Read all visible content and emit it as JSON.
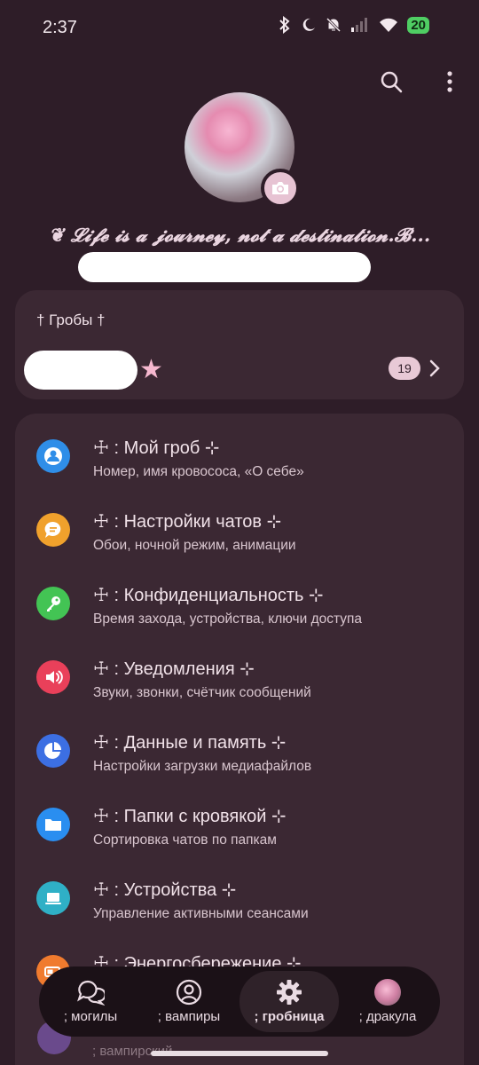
{
  "status_bar": {
    "time": "2:37",
    "battery": "20"
  },
  "profile": {
    "bio": "❦ 𝓛𝓲𝓯𝓮 𝓲𝓼 𝓪 𝓳𝓸𝓾𝓻𝓷𝓮𝔂, 𝓷𝓸𝓽 𝓪 𝓭𝓮𝓼𝓽𝓲𝓷𝓪𝓽𝓲𝓸𝓷.𝓑..."
  },
  "section": {
    "title": "† Гробы †",
    "star": "★",
    "count": "19"
  },
  "menu": [
    {
      "title": "☩ : Мой гроб ⊹",
      "subtitle": "Номер, имя кровососа, «О себе»",
      "icon": "person-icon",
      "color": "#2f8ee8"
    },
    {
      "title": "☩ : Настройки чатов ⊹",
      "subtitle": "Обои, ночной режим, анимации",
      "icon": "chat-bubble-icon",
      "color": "#f0a12c"
    },
    {
      "title": "☩ : Конфиденциальность ⊹",
      "subtitle": "Время захода, устройства, ключи доступа",
      "icon": "key-icon",
      "color": "#43c454"
    },
    {
      "title": "☩ : Уведомления ⊹",
      "subtitle": "Звуки, звонки, счётчик сообщений",
      "icon": "speaker-icon",
      "color": "#e9405a"
    },
    {
      "title": "☩ : Данные и память ⊹",
      "subtitle": "Настройки загрузки медиафайлов",
      "icon": "pie-chart-icon",
      "color": "#3c6fe3"
    },
    {
      "title": "☩ : Папки с кровякой ⊹",
      "subtitle": "Сортировка чатов по папкам",
      "icon": "folder-icon",
      "color": "#2a8ef0"
    },
    {
      "title": "☩ : Устройства ⊹",
      "subtitle": "Управление активными сеансами",
      "icon": "laptop-icon",
      "color": "#2fb0c6"
    },
    {
      "title": "☩ : Энергосбережение ⊹",
      "subtitle": "",
      "icon": "battery-icon",
      "color": "#f07b2e"
    }
  ],
  "peek_text": "; вампирский",
  "nav": [
    {
      "label": "; могилы",
      "icon": "chats-icon"
    },
    {
      "label": "; вампиры",
      "icon": "contacts-icon"
    },
    {
      "label": "; гробница",
      "icon": "gear-icon"
    },
    {
      "label": "; дракула",
      "icon": "profile-avatar"
    }
  ]
}
